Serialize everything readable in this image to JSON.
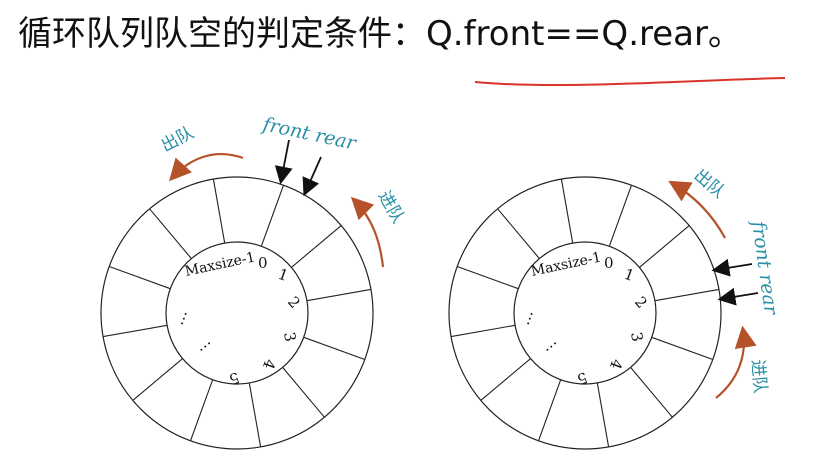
{
  "heading": "循环队列队空的判定条件：Q.front==Q.rear。",
  "labels": {
    "dequeue": "出队",
    "enqueue": "进队",
    "pointers": "front rear",
    "maxsize": "Maxsize-1",
    "dots1": "…",
    "dots2": "…",
    "idx0": "0",
    "idx1": "1",
    "idx2": "2",
    "idx3": "3",
    "idx4": "4",
    "idx5": "5"
  },
  "colors": {
    "accent_teal": "#2a8fa6",
    "arrow_orange": "#b5522a",
    "underline_red": "#d9342b"
  }
}
